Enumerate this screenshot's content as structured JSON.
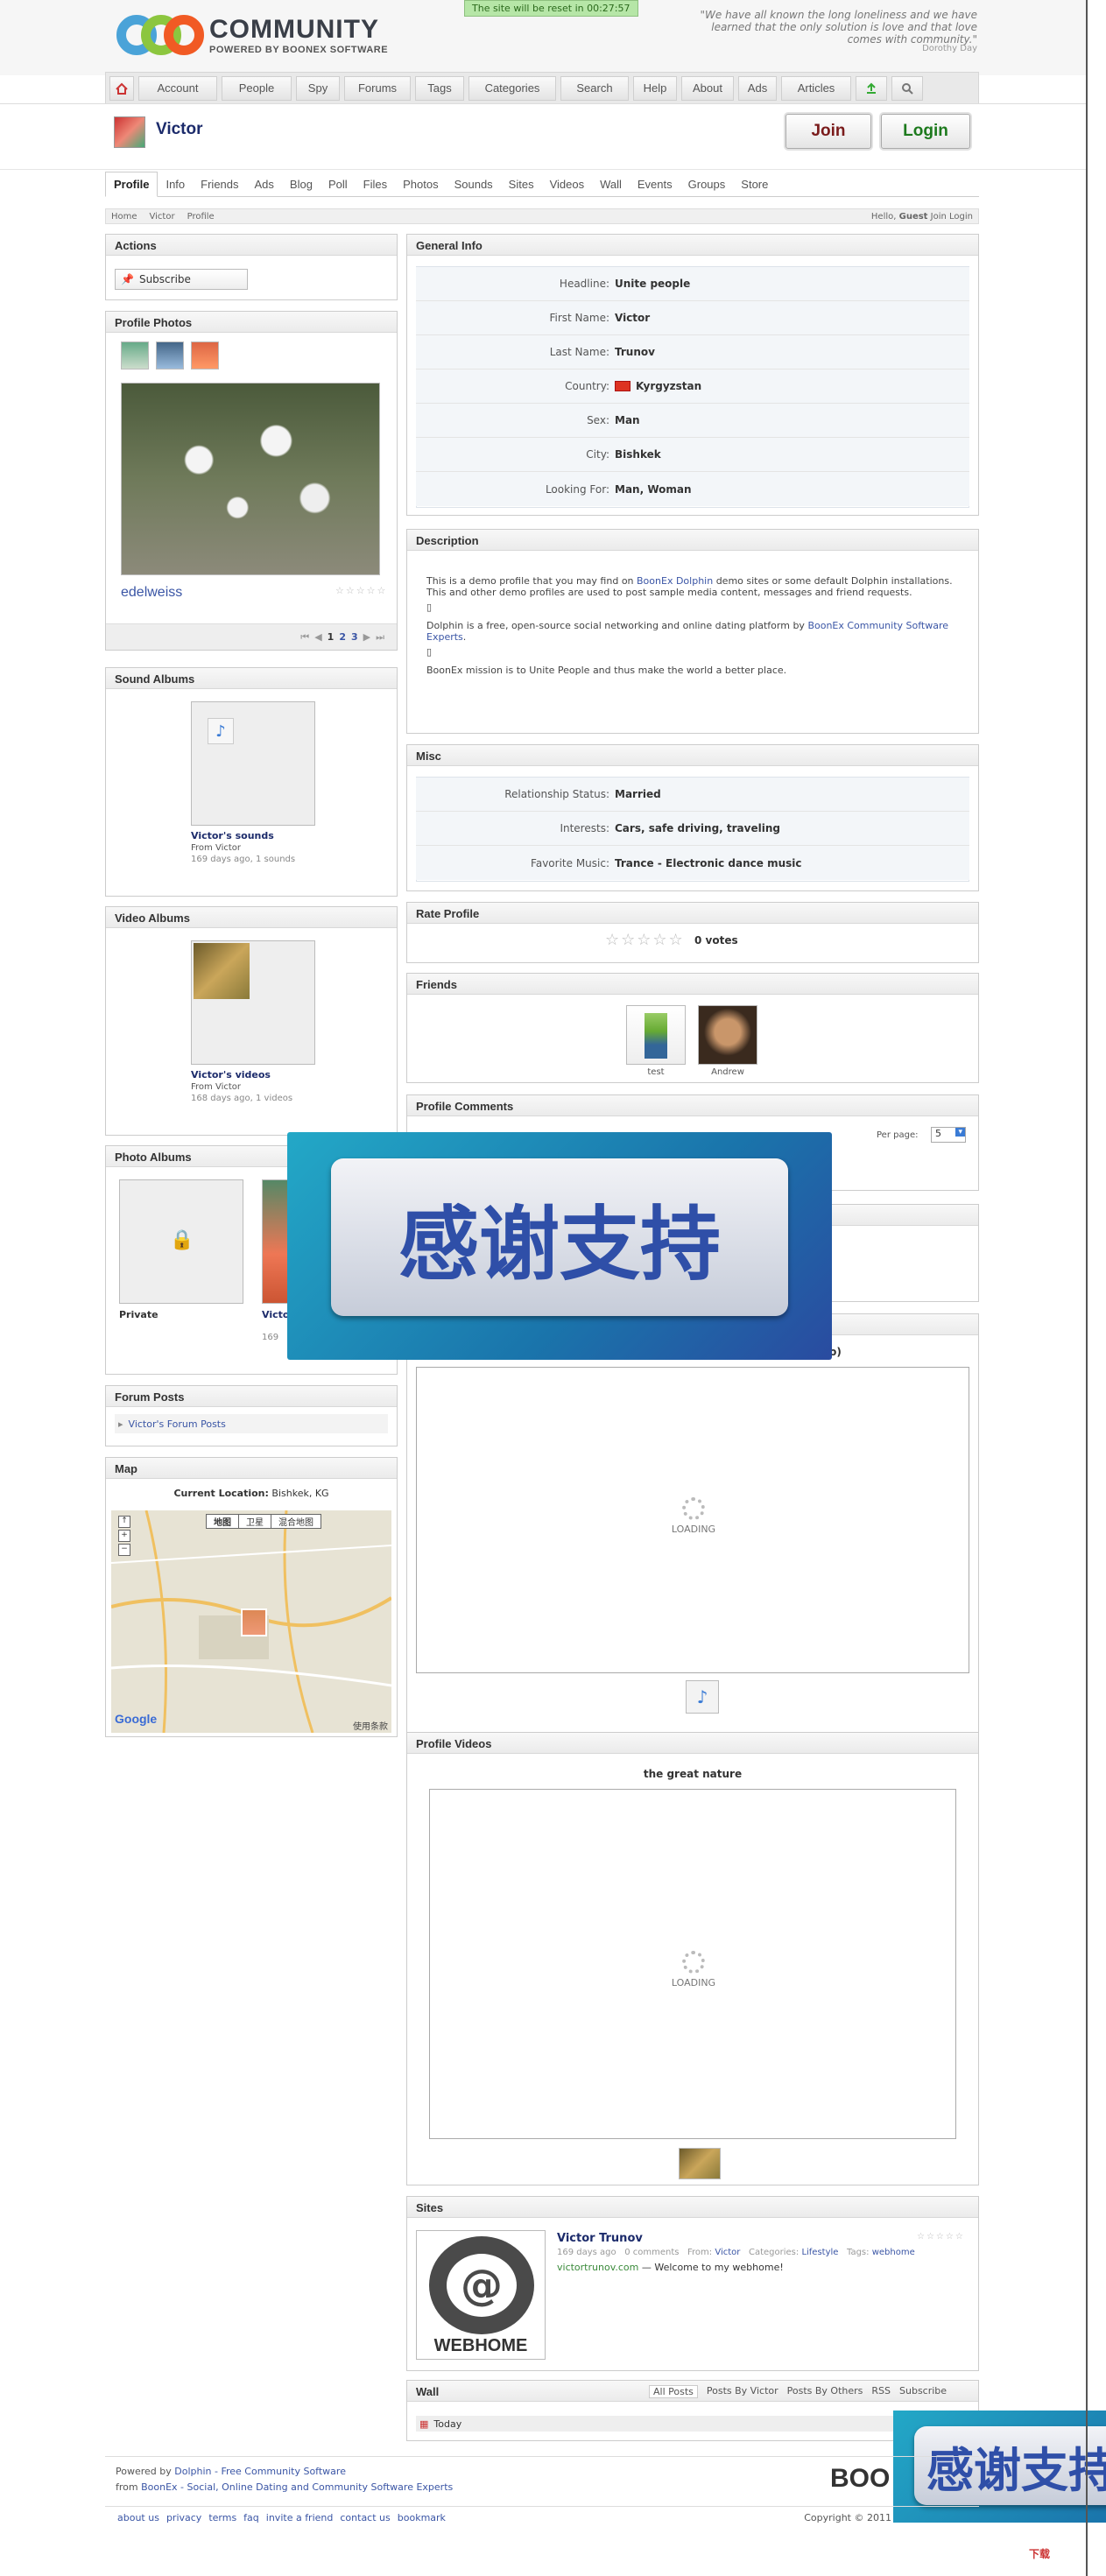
{
  "site": {
    "logo_title": "COMMUNITY",
    "logo_sub": "POWERED BY BOONEX SOFTWARE",
    "reset_notice": "The site will be reset in 00:27:57",
    "quote": "\"We have all known the long loneliness and we have learned that the only solution is love and that love comes with community.\"",
    "quote_author": "Dorothy Day"
  },
  "topnav": [
    "Account",
    "People",
    "Spy",
    "Forums",
    "Tags",
    "Categories",
    "Search",
    "Help",
    "About",
    "Ads",
    "Articles"
  ],
  "profile": {
    "name": "Victor",
    "join": "Join",
    "login": "Login"
  },
  "subnav": [
    "Profile",
    "Info",
    "Friends",
    "Ads",
    "Blog",
    "Poll",
    "Files",
    "Photos",
    "Sounds",
    "Sites",
    "Videos",
    "Wall",
    "Events",
    "Groups",
    "Store"
  ],
  "breadcrumb": [
    "Home",
    "Victor",
    "Profile"
  ],
  "hello": {
    "prefix": "Hello,",
    "user": "Guest",
    "links": "Join  Login"
  },
  "actions": {
    "title": "Actions",
    "subscribe": "Subscribe"
  },
  "profile_photos": {
    "title": "Profile Photos",
    "caption": "edelweiss",
    "pages": [
      "1",
      "2",
      "3"
    ]
  },
  "sound_albums": {
    "title": "Sound Albums",
    "name": "Victor's sounds",
    "from": "From Victor",
    "meta": "169 days ago, 1 sounds"
  },
  "video_albums": {
    "title": "Video Albums",
    "name": "Victor's videos",
    "from": "From Victor",
    "meta": "168 days ago, 1 videos"
  },
  "photo_albums": {
    "title": "Photo Albums",
    "private": "Private",
    "second": "Victo",
    "meta": "169"
  },
  "forum": {
    "title": "Forum Posts",
    "link": "Victor's Forum Posts"
  },
  "map": {
    "title": "Map",
    "location_label": "Current Location:",
    "location": "Bishkek, KG",
    "types": [
      "地图",
      "卫星",
      "混合地图"
    ],
    "terms": "使用条款"
  },
  "general": {
    "title": "General Info",
    "rows": [
      {
        "k": "Headline:",
        "v": "Unite people"
      },
      {
        "k": "First Name:",
        "v": "Victor"
      },
      {
        "k": "Last Name:",
        "v": "Trunov"
      },
      {
        "k": "Country:",
        "v": "Kyrgyzstan"
      },
      {
        "k": "Sex:",
        "v": "Man"
      },
      {
        "k": "City:",
        "v": "Bishkek"
      },
      {
        "k": "Looking For:",
        "v": "Man, Woman"
      }
    ]
  },
  "description": {
    "title": "Description",
    "p1a": "This is a demo profile that you may find on ",
    "p1link": "BoonEx Dolphin",
    "p1b": " demo sites or some default Dolphin installations. This and other demo profiles are used to post sample media content, messages and friend requests.",
    "p2a": "Dolphin is a free, open-source social networking and online dating platform by ",
    "p2link": "BoonEx Community Software Experts",
    "p2b": ".",
    "p3": "BoonEx mission is to Unite People and thus make the world a better place."
  },
  "misc": {
    "title": "Misc",
    "rows": [
      {
        "k": "Relationship Status:",
        "v": "Married"
      },
      {
        "k": "Interests:",
        "v": "Cars, safe driving, traveling"
      },
      {
        "k": "Favorite Music:",
        "v": "Trance - Electronic dance music"
      }
    ]
  },
  "rate": {
    "title": "Rate Profile",
    "votes": "0 votes"
  },
  "friends": {
    "title": "Friends",
    "list": [
      "test",
      "Andrew"
    ]
  },
  "comments": {
    "title": "Profile Comments",
    "per_page": "Per page:",
    "per_page_value": "5"
  },
  "sound_player": {
    "fragment": "lo)",
    "loading": "LOADING"
  },
  "profile_videos": {
    "title": "Profile Videos",
    "video_title": "the great nature",
    "loading": "LOADING"
  },
  "sites": {
    "title": "Sites",
    "name": "Victor Trunov",
    "meta1": "169 days ago",
    "meta2": "0 comments",
    "from_label": "From:",
    "from": "Victor",
    "cat_label": "Categories:",
    "cat": "Lifestyle",
    "tags_label": "Tags:",
    "tags": "webhome",
    "url": "victortrunov.com",
    "desc": " — Welcome to my webhome!",
    "logo_text": "WEBHOME"
  },
  "wall": {
    "title": "Wall",
    "tabs": [
      "All Posts",
      "Posts By Victor",
      "Posts By Others",
      "RSS",
      "Subscribe"
    ],
    "today": "Today"
  },
  "overlay": {
    "text": "感谢支持",
    "text2": "感谢支持"
  },
  "footer": {
    "line1a": "Powered by ",
    "line1b": "Dolphin - Free Community Software",
    "line2a": "from ",
    "line2b": "BoonEx - Social, Online Dating and Community Software Experts",
    "links": [
      "about us",
      "privacy",
      "terms",
      "faq",
      "invite a friend",
      "contact us",
      "bookmark"
    ],
    "copyright": "Copyright © 2011",
    "logo": "BOO"
  },
  "watermark": "下载"
}
